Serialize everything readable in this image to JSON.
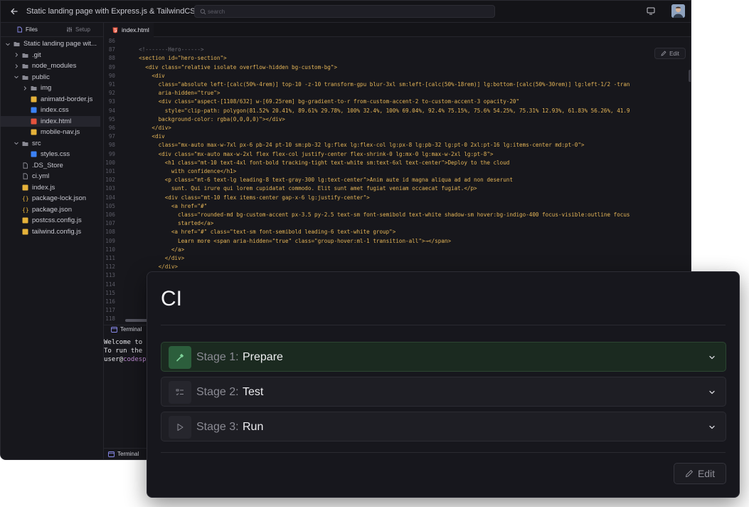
{
  "titlebar": {
    "title": "Static landing page with Express.js & TailwindCSS",
    "search_placeholder": "search"
  },
  "sidebar": {
    "tabs": [
      {
        "label": "Files"
      },
      {
        "label": "Setup"
      }
    ],
    "tree": [
      {
        "label": "Static landing page wit...",
        "kind": "folder",
        "open": true,
        "depth": 0
      },
      {
        "label": ".git",
        "kind": "folder",
        "open": false,
        "depth": 1
      },
      {
        "label": "node_modules",
        "kind": "folder",
        "open": false,
        "depth": 1
      },
      {
        "label": "public",
        "kind": "folder",
        "open": true,
        "depth": 1
      },
      {
        "label": "img",
        "kind": "folder",
        "open": false,
        "depth": 2
      },
      {
        "label": "animatd-border.js",
        "kind": "js",
        "depth": 2
      },
      {
        "label": "index.css",
        "kind": "css",
        "depth": 2
      },
      {
        "label": "index.html",
        "kind": "html",
        "depth": 2,
        "selected": true
      },
      {
        "label": "mobile-nav.js",
        "kind": "js",
        "depth": 2
      },
      {
        "label": "src",
        "kind": "folder",
        "open": true,
        "depth": 1
      },
      {
        "label": "styles.css",
        "kind": "css",
        "depth": 2
      },
      {
        "label": ".DS_Store",
        "kind": "file",
        "depth": 1
      },
      {
        "label": "ci.yml",
        "kind": "file",
        "depth": 1
      },
      {
        "label": "index.js",
        "kind": "js",
        "depth": 1
      },
      {
        "label": "package-lock.json",
        "kind": "json",
        "depth": 1
      },
      {
        "label": "package.json",
        "kind": "json",
        "depth": 1
      },
      {
        "label": "postcss.config.js",
        "kind": "js",
        "depth": 1
      },
      {
        "label": "tailwind.config.js",
        "kind": "js",
        "depth": 1
      }
    ]
  },
  "editor": {
    "tab_label": "index.html",
    "edit_label": "Edit",
    "lines": [
      {
        "n": "86",
        "t": "",
        "k": "text"
      },
      {
        "n": "87",
        "t": "  <!-------Hero------>",
        "k": "comment"
      },
      {
        "n": "88",
        "t": "  <section id=\"hero-section\">",
        "k": "tag"
      },
      {
        "n": "89",
        "t": "    <div class=\"relative isolate overflow-hidden bg-custom-bg\">",
        "k": "tag"
      },
      {
        "n": "90",
        "t": "      <div",
        "k": "tag"
      },
      {
        "n": "91",
        "t": "        class=\"absolute left-[calc(50%-4rem)] top-10 -z-10 transform-gpu blur-3xl sm:left-[calc(50%-18rem)] lg:bottom-[calc(50%-30rem)] lg:left-1/2 -tran",
        "k": "attr"
      },
      {
        "n": "92",
        "t": "        aria-hidden=\"true\">",
        "k": "attr"
      },
      {
        "n": "93",
        "t": "        <div class=\"aspect-[1108/632] w-[69.25rem] bg-gradient-to-r from-custom-accent-2 to-custom-accent-3 opacity-20\"",
        "k": "tag"
      },
      {
        "n": "94",
        "t": "          style=\"clip-path: polygon(81.52% 20.41%, 89.61% 29.78%, 100% 32.4%, 100% 69.04%, 92.4% 75.15%, 75.6% 54.25%, 75.31% 12.93%, 61.83% 56.26%, 41.9",
        "k": "attr"
      },
      {
        "n": "95",
        "t": "        background-color: rgba(0,0,0,0)\"></div>",
        "k": "attr"
      },
      {
        "n": "96",
        "t": "      </div>",
        "k": "tag"
      },
      {
        "n": "97",
        "t": "      <div",
        "k": "tag"
      },
      {
        "n": "98",
        "t": "        class=\"mx-auto max-w-7xl px-6 pb-24 pt-10 sm:pb-32 lg:flex lg:flex-col lg:px-8 lg:pb-32 lg:pt-0 2xl:pt-16 lg:items-center md:pt-0\">",
        "k": "attr"
      },
      {
        "n": "99",
        "t": "        <div class=\"mx-auto max-w-2xl flex flex-col justify-center flex-shrink-0 lg:mx-0 lg:max-w-2xl lg:pt-8\">",
        "k": "tag"
      },
      {
        "n": "100",
        "t": "          <h1 class=\"mt-10 text-4xl font-bold tracking-tight text-white sm:text-6xl text-center\">Deploy to the cloud",
        "k": "tag"
      },
      {
        "n": "101",
        "t": "            with confidence</h1>",
        "k": "tag"
      },
      {
        "n": "102",
        "t": "          <p class=\"mt-6 text-lg leading-8 text-gray-300 lg:text-center\">Anim aute id magna aliqua ad ad non deserunt",
        "k": "tag"
      },
      {
        "n": "103",
        "t": "            sunt. Qui irure qui lorem cupidatat commodo. Elit sunt amet fugiat veniam occaecat fugiat.</p>",
        "k": "tag"
      },
      {
        "n": "104",
        "t": "          <div class=\"mt-10 flex items-center gap-x-6 lg:justify-center\">",
        "k": "tag"
      },
      {
        "n": "105",
        "t": "            <a href=\"#\"",
        "k": "tag"
      },
      {
        "n": "106",
        "t": "              class=\"rounded-md bg-custom-accent px-3.5 py-2.5 text-sm font-semibold text-white shadow-sm hover:bg-indigo-400 focus-visible:outline focus",
        "k": "attr"
      },
      {
        "n": "107",
        "t": "              started</a>",
        "k": "tag"
      },
      {
        "n": "108",
        "t": "            <a href=\"#\" class=\"text-sm font-semibold leading-6 text-white group\">",
        "k": "tag"
      },
      {
        "n": "109",
        "t": "              Learn more <span aria-hidden=\"true\" class=\"group-hover:ml-1 transition-all\">→</span>",
        "k": "tag"
      },
      {
        "n": "110",
        "t": "            </a>",
        "k": "tag"
      },
      {
        "n": "111",
        "t": "          </div>",
        "k": "tag"
      },
      {
        "n": "112",
        "t": "        </div>",
        "k": "tag"
      },
      {
        "n": "113",
        "t": "",
        "k": "text"
      },
      {
        "n": "114",
        "t": "",
        "k": "text"
      },
      {
        "n": "115",
        "t": "",
        "k": "text"
      },
      {
        "n": "116",
        "t": "",
        "k": "text"
      },
      {
        "n": "117",
        "t": "",
        "k": "text"
      },
      {
        "n": "118",
        "t": "",
        "k": "text"
      }
    ]
  },
  "terminal": {
    "tab_label": "Terminal",
    "lines": [
      "Welcome to",
      "To run the"
    ],
    "prompt_user": "user@",
    "prompt_host": "codesp",
    "bottom_tab_label": "Terminal"
  },
  "ci": {
    "title": "CI",
    "stages": [
      {
        "num": "Stage 1:",
        "name": "Prepare",
        "icon": "hammer-icon",
        "active": true
      },
      {
        "num": "Stage 2:",
        "name": "Test",
        "icon": "checklist-icon",
        "active": false
      },
      {
        "num": "Stage 3:",
        "name": "Run",
        "icon": "play-icon",
        "active": false
      }
    ],
    "edit_label": "Edit"
  },
  "colors": {
    "file_html": "#e5533d",
    "file_css": "#3b82f6",
    "file_js": "#e5b23a",
    "file_json": "#e5b23a",
    "active_stage": "#2c5e3c"
  }
}
